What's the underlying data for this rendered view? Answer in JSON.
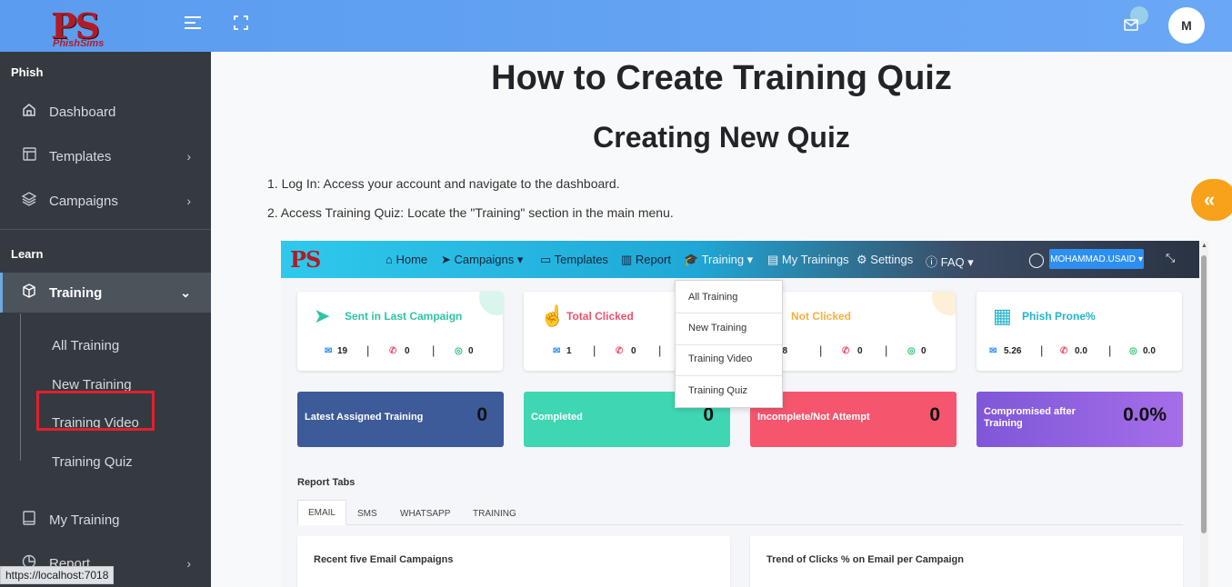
{
  "app": {
    "logo_text": "PS",
    "logo_sub": "PhishSims",
    "avatar_initial": "M"
  },
  "sidebar": {
    "section_phish": "Phish",
    "section_learn": "Learn",
    "items": [
      {
        "label": "Dashboard"
      },
      {
        "label": "Templates"
      },
      {
        "label": "Campaigns"
      },
      {
        "label": "Training"
      },
      {
        "label": "My Training"
      },
      {
        "label": "Report"
      }
    ],
    "training_sub": [
      "All Training",
      "New Training",
      "Training Video",
      "Training Quiz"
    ]
  },
  "main": {
    "title": "How to Create Training Quiz",
    "subtitle": "Creating New Quiz",
    "steps": [
      "1. Log In: Access your account and navigate to the dashboard.",
      "2. Access Training Quiz: Locate the \"Training\" section in the main menu."
    ]
  },
  "shot": {
    "logo": "PS",
    "nav": [
      "Home",
      "Campaigns",
      "Templates",
      "Report",
      "Training",
      "My Trainings",
      "Settings",
      "FAQ"
    ],
    "user": "MOHAMMAD.USAID",
    "dropdown": [
      "All Training",
      "New Training",
      "Training Video",
      "Training Quiz"
    ],
    "cards": [
      {
        "title": "Sent in Last Campaign",
        "color": "#2ec4a4",
        "stats": [
          "19",
          "0",
          "0"
        ]
      },
      {
        "title": "Total Clicked",
        "color": "#f0506e",
        "stats": [
          "1",
          "0",
          "0"
        ]
      },
      {
        "title": "Not Clicked",
        "color": "#f5b041",
        "stats": [
          "18",
          "0",
          "0"
        ]
      },
      {
        "title": "Phish Prone%",
        "color": "#22b5cc",
        "stats": [
          "5.26",
          "0.0",
          "0.0"
        ]
      }
    ],
    "tiles": [
      {
        "label": "Latest Assigned Training",
        "value": "0",
        "color": "#3d5a99"
      },
      {
        "label": "Completed",
        "value": "0",
        "color": "#3fd6b4"
      },
      {
        "label": "Incomplete/Not Attempt",
        "value": "0",
        "color": "#f5566e"
      },
      {
        "label": "Compromised after Training",
        "value": "0.0%",
        "color": "#8a5ce0"
      }
    ],
    "report_tabs_title": "Report Tabs",
    "report_tabs": [
      "EMAIL",
      "SMS",
      "WHATSAPP",
      "TRAINING"
    ],
    "panels": [
      "Recent five Email Campaigns",
      "Trend of Clicks % on Email per Campaign"
    ]
  },
  "status_url": "https://localhost:7018",
  "colors": {
    "accent": "#5b9cf0",
    "sidebar": "#343a40",
    "highlight": "#e3202d",
    "collapse": "#f7a21a"
  }
}
